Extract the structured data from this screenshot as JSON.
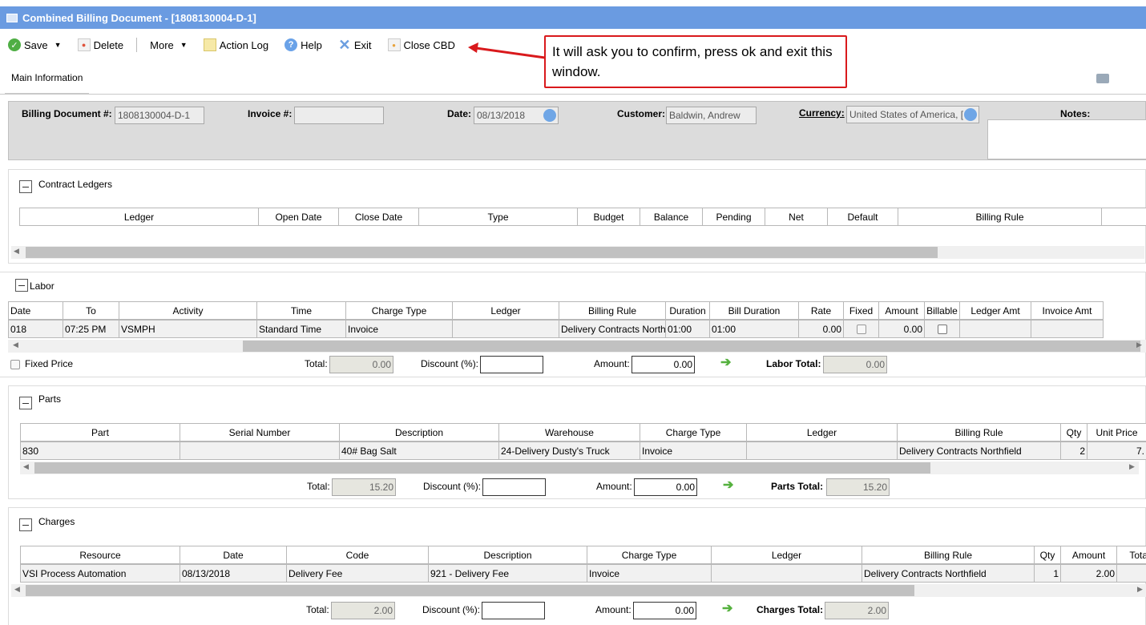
{
  "window": {
    "title": "Combined Billing Document - [1808130004-D-1]"
  },
  "toolbar": {
    "save": "Save",
    "delete": "Delete",
    "more": "More",
    "action_log": "Action Log",
    "help": "Help",
    "exit": "Exit",
    "close_cbd": "Close CBD"
  },
  "callout": {
    "text": "It will ask you to confirm, press ok and exit this window."
  },
  "tabs": {
    "main": "Main Information"
  },
  "header": {
    "billing_doc_label": "Billing Document #:",
    "billing_doc_value": "1808130004-D-1",
    "invoice_label": "Invoice #:",
    "invoice_value": "",
    "date_label": "Date:",
    "date_value": "08/13/2018",
    "customer_label": "Customer:",
    "customer_value": "Baldwin, Andrew",
    "currency_label": "Currency:",
    "currency_value": "United States of America, [",
    "notes_label": "Notes:"
  },
  "contract_ledgers": {
    "title": "Contract Ledgers",
    "columns": [
      "Ledger",
      "Open Date",
      "Close Date",
      "Type",
      "Budget",
      "Balance",
      "Pending",
      "Net",
      "Default",
      "Billing Rule"
    ]
  },
  "labor": {
    "title": "Labor",
    "columns": [
      "Date",
      "To",
      "Activity",
      "Time",
      "Charge Type",
      "Ledger",
      "Billing Rule",
      "Duration",
      "Bill Duration",
      "Rate",
      "Fixed",
      "Amount",
      "Billable",
      "Ledger Amt",
      "Invoice Amt"
    ],
    "row": {
      "date": "018",
      "to": "07:25 PM",
      "activity": "VSMPH",
      "time": "Standard Time",
      "charge_type": "Invoice",
      "ledger": "",
      "billing_rule": "Delivery Contracts North",
      "duration": "01:00",
      "bill_duration": "01:00",
      "rate": "0.00",
      "amount": "0.00"
    },
    "fixed_price_label": "Fixed Price",
    "total_label": "Total:",
    "total_value": "0.00",
    "discount_label": "Discount (%):",
    "discount_value": "",
    "amount_label": "Amount:",
    "amount_value": "0.00",
    "grand_label": "Labor Total:",
    "grand_value": "0.00"
  },
  "parts": {
    "title": "Parts",
    "columns": [
      "Part",
      "Serial Number",
      "Description",
      "Warehouse",
      "Charge Type",
      "Ledger",
      "Billing Rule",
      "Qty",
      "Unit Price"
    ],
    "row": {
      "part": "830",
      "serial": "",
      "description": "40# Bag Salt",
      "warehouse": "24-Delivery Dusty's Truck",
      "charge_type": "Invoice",
      "ledger": "",
      "billing_rule": "Delivery Contracts Northfield",
      "qty": "2",
      "unit_price": "7."
    },
    "total_label": "Total:",
    "total_value": "15.20",
    "discount_label": "Discount (%):",
    "discount_value": "",
    "amount_label": "Amount:",
    "amount_value": "0.00",
    "grand_label": "Parts Total:",
    "grand_value": "15.20"
  },
  "charges": {
    "title": "Charges",
    "columns": [
      "Resource",
      "Date",
      "Code",
      "Description",
      "Charge Type",
      "Ledger",
      "Billing Rule",
      "Qty",
      "Amount",
      "Tota"
    ],
    "row": {
      "resource": "VSI Process Automation",
      "date": "08/13/2018",
      "code": "Delivery Fee",
      "description": "921 - Delivery Fee",
      "charge_type": "Invoice",
      "ledger": "",
      "billing_rule": "Delivery Contracts Northfield",
      "qty": "1",
      "amount": "2.00",
      "total": ""
    },
    "total_label": "Total:",
    "total_value": "2.00",
    "discount_label": "Discount (%):",
    "discount_value": "",
    "amount_label": "Amount:",
    "amount_value": "0.00",
    "grand_label": "Charges Total:",
    "grand_value": "2.00"
  },
  "colors": {
    "titlebar": "#6a9be1",
    "callout_border": "#d9191c",
    "arrow_green": "#55b13e"
  }
}
